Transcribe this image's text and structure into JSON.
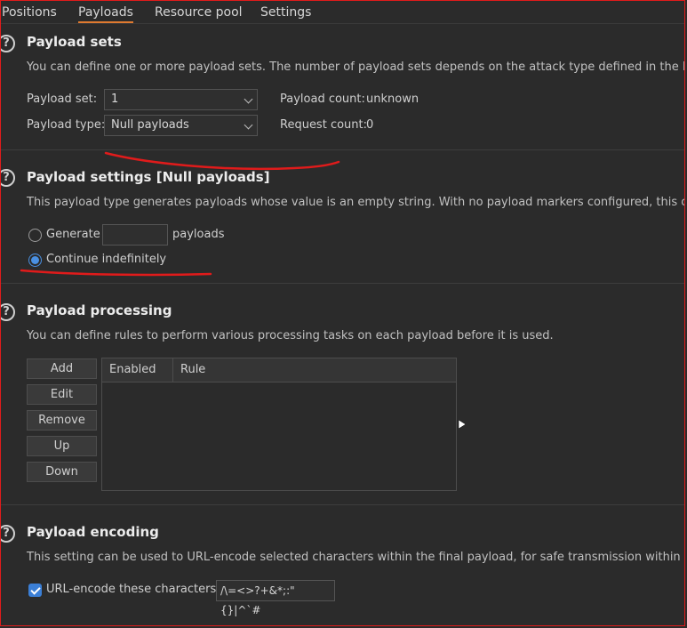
{
  "tabs": [
    {
      "label": "Positions"
    },
    {
      "label": "Payloads"
    },
    {
      "label": "Resource pool"
    },
    {
      "label": "Settings"
    }
  ],
  "payload_sets": {
    "title": "Payload sets",
    "description": "You can define one or more payload sets. The number of payload sets depends on the attack type defined in the Position",
    "set_label": "Payload set:",
    "set_value": "1",
    "type_label": "Payload type:",
    "type_value": "Null payloads",
    "payload_count_label": "Payload count:",
    "payload_count_value": "unknown",
    "request_count_label": "Request count:",
    "request_count_value": "0"
  },
  "payload_settings": {
    "title": "Payload settings [Null payloads]",
    "description": "This payload type generates payloads whose value is an empty string. With no payload markers configured, this can be us",
    "generate_label": "Generate",
    "generate_value": "",
    "payloads_suffix": "payloads",
    "continue_label": "Continue indefinitely"
  },
  "payload_processing": {
    "title": "Payload processing",
    "description": "You can define rules to perform various processing tasks on each payload before it is used.",
    "buttons": {
      "add": "Add",
      "edit": "Edit",
      "remove": "Remove",
      "up": "Up",
      "down": "Down"
    },
    "columns": [
      "Enabled",
      "Rule"
    ]
  },
  "payload_encoding": {
    "title": "Payload encoding",
    "description": "This setting can be used to URL-encode selected characters within the final payload, for safe transmission within HTTP re",
    "checkbox_label": "URL-encode these characters:",
    "characters": "/\\=<>?+&*;:\"{}|^`#"
  },
  "icons": {
    "help": "?"
  },
  "colors": {
    "background": "#2b2b2b",
    "accent_tab": "#e07a30",
    "radio_selected": "#4a90e2",
    "annotation": "#e01b1b"
  }
}
